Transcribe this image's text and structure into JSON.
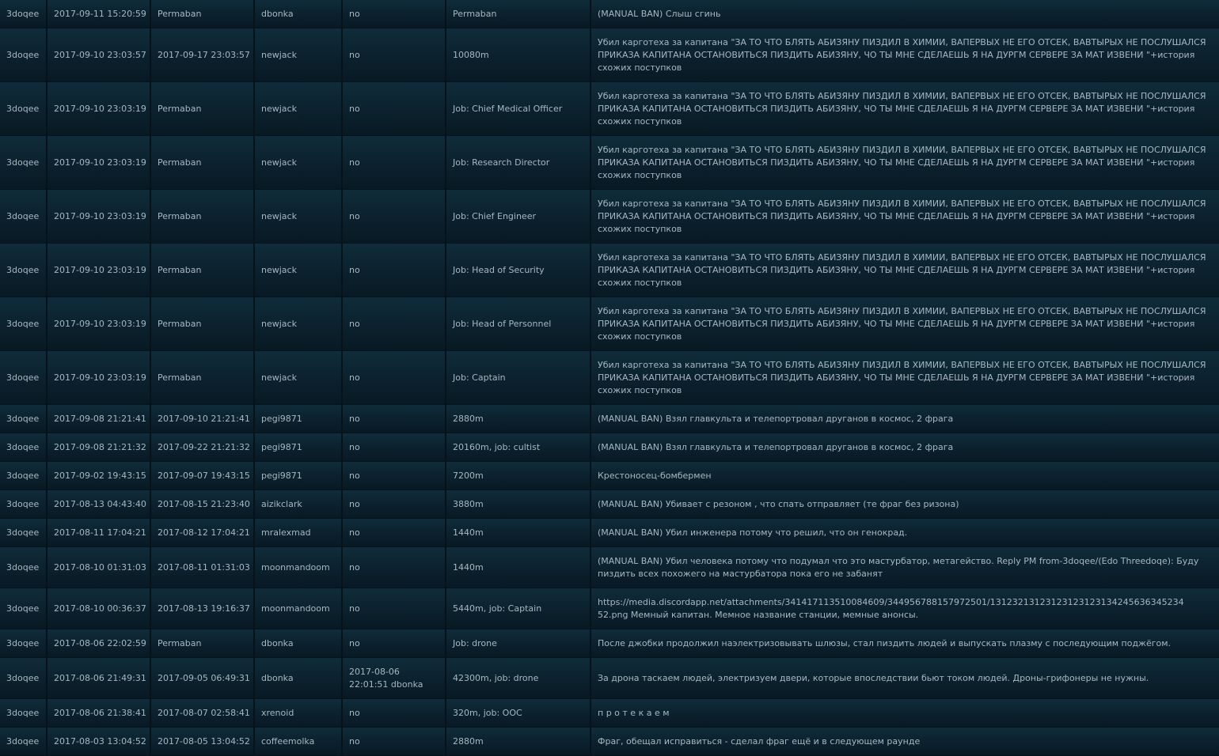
{
  "ban_rows": [
    {
      "admin": "3doqee",
      "banned_at": "2017-09-11 15:20:59",
      "expires": "Permaban",
      "player": "dbonka",
      "unbanned": "no",
      "duration": "Permaban",
      "reason": "(MANUAL BAN) Слыш сгинь"
    },
    {
      "admin": "3doqee",
      "banned_at": "2017-09-10 23:03:57",
      "expires": "2017-09-17 23:03:57",
      "player": "newjack",
      "unbanned": "no",
      "duration": "10080m",
      "reason": "Убил карготеха за капитана \"ЗА ТО ЧТО БЛЯТЬ АБИЗЯНУ ПИЗДИЛ В ХИМИИ, ВАПЕРВЫХ НЕ ЕГО ОТСЕК, ВАВТЫРЫХ НЕ ПОСЛУШАЛСЯ ПРИКАЗА КАПИТАНА ОСТАНОВИТЬСЯ ПИЗДИТЬ АБИЗЯНУ, ЧО ТЫ МНЕ СДЕЛАЕШЬ Я НА ДУРГМ СЕРВЕРЕ ЗА МАТ ИЗВЕНИ \"+история схожих поступков"
    },
    {
      "admin": "3doqee",
      "banned_at": "2017-09-10 23:03:19",
      "expires": "Permaban",
      "player": "newjack",
      "unbanned": "no",
      "duration": "Job: Chief Medical Officer",
      "reason": "Убил карготеха за капитана \"ЗА ТО ЧТО БЛЯТЬ АБИЗЯНУ ПИЗДИЛ В ХИМИИ, ВАПЕРВЫХ НЕ ЕГО ОТСЕК, ВАВТЫРЫХ НЕ ПОСЛУШАЛСЯ ПРИКАЗА КАПИТАНА ОСТАНОВИТЬСЯ ПИЗДИТЬ АБИЗЯНУ, ЧО ТЫ МНЕ СДЕЛАЕШЬ Я НА ДУРГМ СЕРВЕРЕ ЗА МАТ ИЗВЕНИ \"+история схожих поступков"
    },
    {
      "admin": "3doqee",
      "banned_at": "2017-09-10 23:03:19",
      "expires": "Permaban",
      "player": "newjack",
      "unbanned": "no",
      "duration": "Job: Research Director",
      "reason": "Убил карготеха за капитана \"ЗА ТО ЧТО БЛЯТЬ АБИЗЯНУ ПИЗДИЛ В ХИМИИ, ВАПЕРВЫХ НЕ ЕГО ОТСЕК, ВАВТЫРЫХ НЕ ПОСЛУШАЛСЯ ПРИКАЗА КАПИТАНА ОСТАНОВИТЬСЯ ПИЗДИТЬ АБИЗЯНУ, ЧО ТЫ МНЕ СДЕЛАЕШЬ Я НА ДУРГМ СЕРВЕРЕ ЗА МАТ ИЗВЕНИ \"+история схожих поступков"
    },
    {
      "admin": "3doqee",
      "banned_at": "2017-09-10 23:03:19",
      "expires": "Permaban",
      "player": "newjack",
      "unbanned": "no",
      "duration": "Job: Chief Engineer",
      "reason": "Убил карготеха за капитана \"ЗА ТО ЧТО БЛЯТЬ АБИЗЯНУ ПИЗДИЛ В ХИМИИ, ВАПЕРВЫХ НЕ ЕГО ОТСЕК, ВАВТЫРЫХ НЕ ПОСЛУШАЛСЯ ПРИКАЗА КАПИТАНА ОСТАНОВИТЬСЯ ПИЗДИТЬ АБИЗЯНУ, ЧО ТЫ МНЕ СДЕЛАЕШЬ Я НА ДУРГМ СЕРВЕРЕ ЗА МАТ ИЗВЕНИ \"+история схожих поступков"
    },
    {
      "admin": "3doqee",
      "banned_at": "2017-09-10 23:03:19",
      "expires": "Permaban",
      "player": "newjack",
      "unbanned": "no",
      "duration": "Job: Head of Security",
      "reason": "Убил карготеха за капитана \"ЗА ТО ЧТО БЛЯТЬ АБИЗЯНУ ПИЗДИЛ В ХИМИИ, ВАПЕРВЫХ НЕ ЕГО ОТСЕК, ВАВТЫРЫХ НЕ ПОСЛУШАЛСЯ ПРИКАЗА КАПИТАНА ОСТАНОВИТЬСЯ ПИЗДИТЬ АБИЗЯНУ, ЧО ТЫ МНЕ СДЕЛАЕШЬ Я НА ДУРГМ СЕРВЕРЕ ЗА МАТ ИЗВЕНИ \"+история схожих поступков"
    },
    {
      "admin": "3doqee",
      "banned_at": "2017-09-10 23:03:19",
      "expires": "Permaban",
      "player": "newjack",
      "unbanned": "no",
      "duration": "Job: Head of Personnel",
      "reason": "Убил карготеха за капитана \"ЗА ТО ЧТО БЛЯТЬ АБИЗЯНУ ПИЗДИЛ В ХИМИИ, ВАПЕРВЫХ НЕ ЕГО ОТСЕК, ВАВТЫРЫХ НЕ ПОСЛУШАЛСЯ ПРИКАЗА КАПИТАНА ОСТАНОВИТЬСЯ ПИЗДИТЬ АБИЗЯНУ, ЧО ТЫ МНЕ СДЕЛАЕШЬ Я НА ДУРГМ СЕРВЕРЕ ЗА МАТ ИЗВЕНИ \"+история схожих поступков"
    },
    {
      "admin": "3doqee",
      "banned_at": "2017-09-10 23:03:19",
      "expires": "Permaban",
      "player": "newjack",
      "unbanned": "no",
      "duration": "Job: Captain",
      "reason": "Убил карготеха за капитана \"ЗА ТО ЧТО БЛЯТЬ АБИЗЯНУ ПИЗДИЛ В ХИМИИ, ВАПЕРВЫХ НЕ ЕГО ОТСЕК, ВАВТЫРЫХ НЕ ПОСЛУШАЛСЯ ПРИКАЗА КАПИТАНА ОСТАНОВИТЬСЯ ПИЗДИТЬ АБИЗЯНУ, ЧО ТЫ МНЕ СДЕЛАЕШЬ Я НА ДУРГМ СЕРВЕРЕ ЗА МАТ ИЗВЕНИ \"+история схожих поступков"
    },
    {
      "admin": "3doqee",
      "banned_at": "2017-09-08 21:21:41",
      "expires": "2017-09-10 21:21:41",
      "player": "pegi9871",
      "unbanned": "no",
      "duration": "2880m",
      "reason": "(MANUAL BAN) Взял главкульта и телепортровал друганов в космос, 2 фрага"
    },
    {
      "admin": "3doqee",
      "banned_at": "2017-09-08 21:21:32",
      "expires": "2017-09-22 21:21:32",
      "player": "pegi9871",
      "unbanned": "no",
      "duration": "20160m, job: cultist",
      "reason": "(MANUAL BAN) Взял главкульта и телепортровал друганов в космос, 2 фрага"
    },
    {
      "admin": "3doqee",
      "banned_at": "2017-09-02 19:43:15",
      "expires": "2017-09-07 19:43:15",
      "player": "pegi9871",
      "unbanned": "no",
      "duration": "7200m",
      "reason": "Крестоносец-бомбермен"
    },
    {
      "admin": "3doqee",
      "banned_at": "2017-08-13 04:43:40",
      "expires": "2017-08-15 21:23:40",
      "player": "aizikclark",
      "unbanned": "no",
      "duration": "3880m",
      "reason": "(MANUAL BAN) Убивает с резоном , что спать отправляет (те фраг без ризона)"
    },
    {
      "admin": "3doqee",
      "banned_at": "2017-08-11 17:04:21",
      "expires": "2017-08-12 17:04:21",
      "player": "mralexmad",
      "unbanned": "no",
      "duration": "1440m",
      "reason": "(MANUAL BAN) Убил инженера потому что решил, что он генокрад."
    },
    {
      "admin": "3doqee",
      "banned_at": "2017-08-10 01:31:03",
      "expires": "2017-08-11 01:31:03",
      "player": "moonmandoom",
      "unbanned": "no",
      "duration": "1440m",
      "reason": "(MANUAL BAN) Убил человека потому что подумал что это мастурбатор, метагейство. Reply PM from-3doqee/(Edo Threedoqe): Буду пиздить всех похожего на мастурбатора пока его не забанят"
    },
    {
      "admin": "3doqee",
      "banned_at": "2017-08-10 00:36:37",
      "expires": "2017-08-13 19:16:37",
      "player": "moonmandoom",
      "unbanned": "no",
      "duration": "5440m, job: Captain",
      "reason": "https://media.discordapp.net/attachments/341417113510084609/344956788157972501/13123213123123123123134245636345234 52.png Мемный капитан. Мемное название станции, мемные анонсы."
    },
    {
      "admin": "3doqee",
      "banned_at": "2017-08-06 22:02:59",
      "expires": "Permaban",
      "player": "dbonka",
      "unbanned": "no",
      "duration": "Job: drone",
      "reason": "После джобки продолжил наэлектризовывать шлюзы, стал пиздить людей и выпускать плазму с последующим поджёгом."
    },
    {
      "admin": "3doqee",
      "banned_at": "2017-08-06 21:49:31",
      "expires": "2017-09-05 06:49:31",
      "player": "dbonka",
      "unbanned": "2017-08-06 22:01:51 dbonka",
      "duration": "42300m, job: drone",
      "reason": "За дрона таскаем людей, электризуем двери, которые впоследствии бьют током людей. Дроны-грифонеры не нужны."
    },
    {
      "admin": "3doqee",
      "banned_at": "2017-08-06 21:38:41",
      "expires": "2017-08-07 02:58:41",
      "player": "xrenoid",
      "unbanned": "no",
      "duration": "320m, job: OOC",
      "reason": "п р о т е к а е м"
    },
    {
      "admin": "3doqee",
      "banned_at": "2017-08-03 13:04:52",
      "expires": "2017-08-05 13:04:52",
      "player": "coffeemolka",
      "unbanned": "no",
      "duration": "2880m",
      "reason": "Фраг, обещал исправиться - сделал фраг ещё и в следующем раунде"
    }
  ]
}
